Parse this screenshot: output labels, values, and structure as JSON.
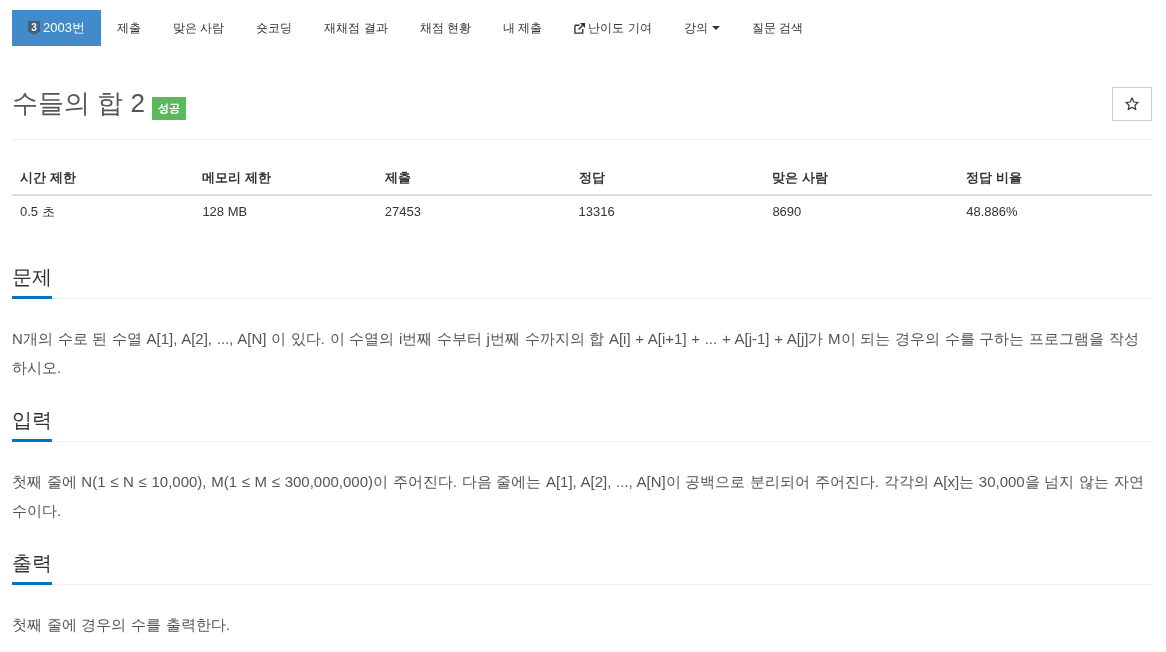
{
  "nav": {
    "items": [
      {
        "label": "2003번",
        "kind": "problem",
        "badge": "3",
        "selected": true
      },
      {
        "label": "제출",
        "kind": "plain",
        "selected": false
      },
      {
        "label": "맞은 사람",
        "kind": "plain",
        "selected": false
      },
      {
        "label": "숏코딩",
        "kind": "plain",
        "selected": false
      },
      {
        "label": "재채점 결과",
        "kind": "plain",
        "selected": false
      },
      {
        "label": "채점 현황",
        "kind": "plain",
        "selected": false
      },
      {
        "label": "내 제출",
        "kind": "plain",
        "selected": false
      },
      {
        "label": "난이도 기여",
        "kind": "external",
        "selected": false
      },
      {
        "label": "강의",
        "kind": "dropdown",
        "selected": false
      },
      {
        "label": "질문 검색",
        "kind": "plain",
        "selected": false
      }
    ]
  },
  "problem": {
    "title": "수들의 합 2",
    "status": "성공",
    "starred": false
  },
  "info_table": {
    "columns": [
      "시간 제한",
      "메모리 제한",
      "제출",
      "정답",
      "맞은 사람",
      "정답 비율"
    ],
    "rows": [
      [
        "0.5 초",
        "128 MB",
        "27453",
        "13316",
        "8690",
        "48.886%"
      ]
    ]
  },
  "sections": [
    {
      "heading": "문제",
      "body": "N개의 수로 된 수열 A[1], A[2], ..., A[N] 이 있다. 이 수열의 i번째 수부터 j번째 수까지의 합 A[i] + A[i+1] + ... + A[j-1] + A[j]가 M이 되는 경우의 수를 구하는 프로그램을 작성하시오."
    },
    {
      "heading": "입력",
      "body": "첫째 줄에 N(1 ≤ N ≤ 10,000), M(1 ≤ M ≤ 300,000,000)이 주어진다. 다음 줄에는 A[1], A[2], ..., A[N]이 공백으로 분리되어 주어진다. 각각의 A[x]는 30,000을 넘지 않는 자연수이다."
    },
    {
      "heading": "출력",
      "body": "첫째 줄에 경우의 수를 출력한다."
    }
  ]
}
